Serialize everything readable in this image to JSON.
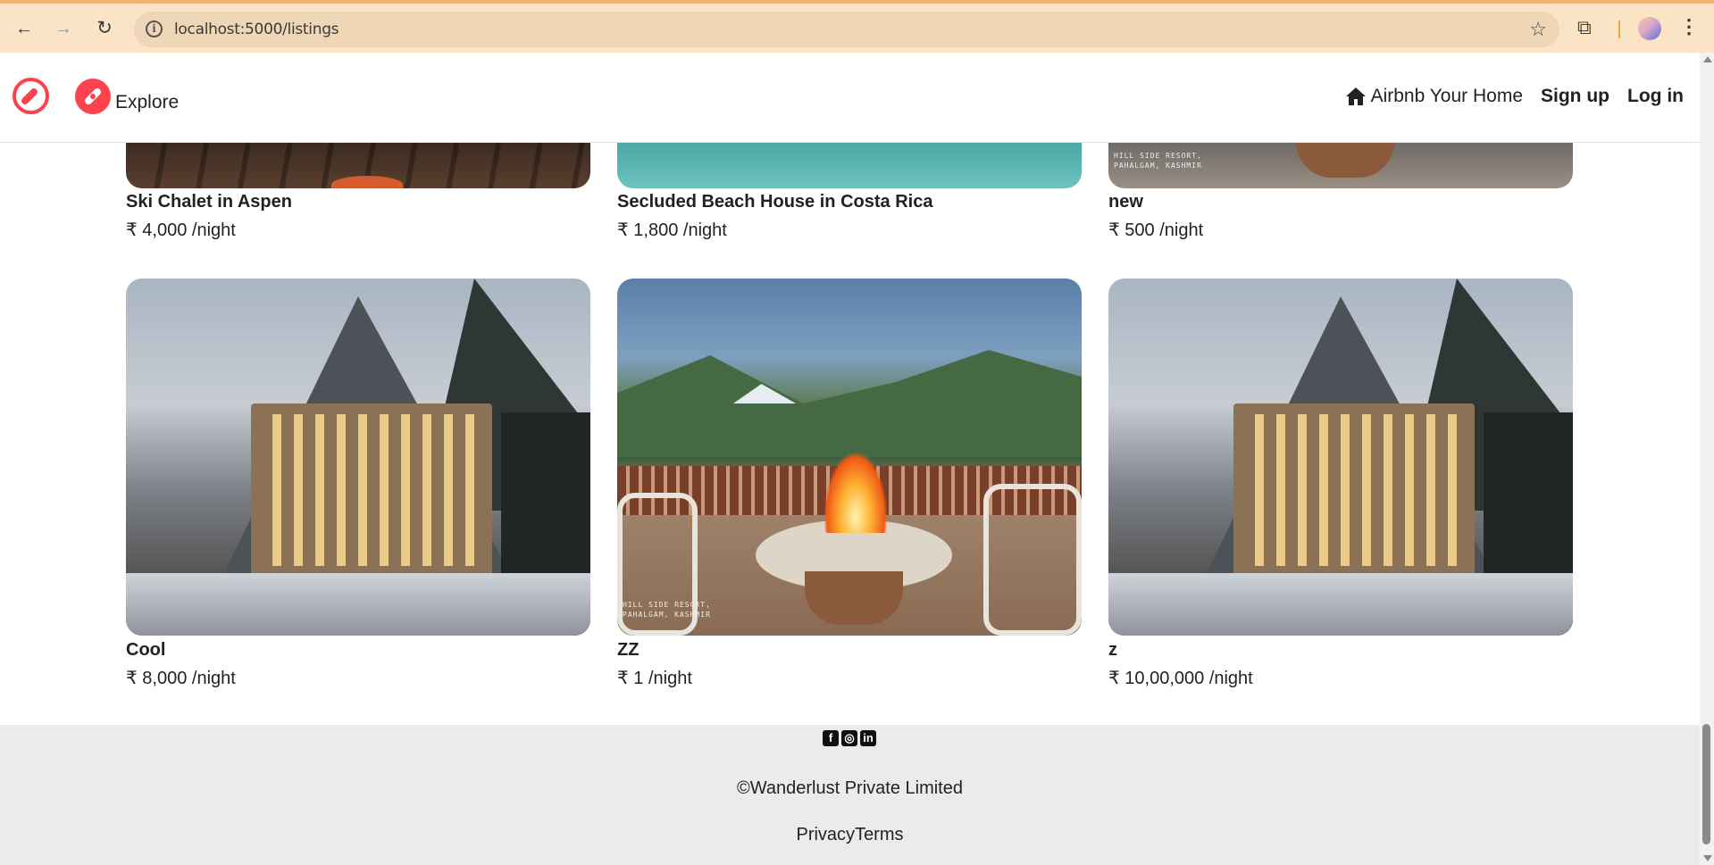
{
  "browser": {
    "url": "localhost:5000/listings"
  },
  "navbar": {
    "explore_label": "Explore",
    "host_label": "Airbnb Your Home",
    "signup_label": "Sign up",
    "login_label": "Log in"
  },
  "listings_top": [
    {
      "title": "Ski Chalet in Aspen",
      "price": "₹ 4,000 /night"
    },
    {
      "title": "Secluded Beach House in Costa Rica",
      "price": "₹ 1,800 /night"
    },
    {
      "title": "new",
      "price": "₹ 500 /night"
    }
  ],
  "listings": [
    {
      "title": "Cool",
      "price": "₹ 8,000 /night"
    },
    {
      "title": "ZZ",
      "price": "₹ 1 /night"
    },
    {
      "title": "z",
      "price": "₹ 10,00,000 /night"
    }
  ],
  "watermark": {
    "line1": "HILL SIDE RESORT,",
    "line2": "PAHALGAM, KASHMIR"
  },
  "footer": {
    "socials": [
      "facebook-icon",
      "instagram-icon",
      "linkedin-icon"
    ],
    "copyright": "©Wanderlust Private Limited",
    "privacy": "Privacy",
    "terms": "Terms"
  },
  "colors": {
    "brand": "#fe424d",
    "chrome_bg": "#fbe3c6",
    "footer_bg": "#ebebeb"
  }
}
